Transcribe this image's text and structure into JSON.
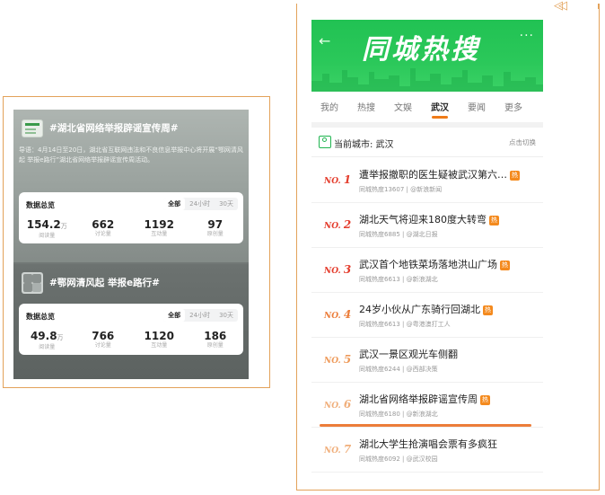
{
  "left": {
    "topic1": {
      "title": "#湖北省网络举报辟谣宣传周#",
      "desc": "导语：4月14日至20日，湖北省互联网违法和不良信息举报中心将开展“鄂网清风起 举报e路行”湖北省网络举报辟谣宣传周活动。",
      "stats_title": "数据总览",
      "tabs": [
        "全部",
        "24小时",
        "30天"
      ],
      "stats": [
        {
          "value": "154.2",
          "unit": "万",
          "label": "阅读量"
        },
        {
          "value": "662",
          "unit": "",
          "label": "讨论量"
        },
        {
          "value": "1192",
          "unit": "",
          "label": "互动量"
        },
        {
          "value": "97",
          "unit": "",
          "label": "原创量"
        }
      ]
    },
    "topic2": {
      "title": "#鄂网清风起 举报e路行#",
      "stats_title": "数据总览",
      "tabs": [
        "全部",
        "24小时",
        "30天"
      ],
      "stats": [
        {
          "value": "49.8",
          "unit": "万",
          "label": "阅读量"
        },
        {
          "value": "766",
          "unit": "",
          "label": "讨论量"
        },
        {
          "value": "1120",
          "unit": "",
          "label": "互动量"
        },
        {
          "value": "186",
          "unit": "",
          "label": "原创量"
        }
      ]
    }
  },
  "right": {
    "banner_title": "同城热搜",
    "back_icon": "arrow-left-icon",
    "more_icon": "more-dots-icon",
    "tabs": [
      "我的",
      "热搜",
      "文娱",
      "武汉",
      "要闻",
      "更多"
    ],
    "active_tab": "武汉",
    "city_label": "当前城市: 武汉",
    "city_switch": "点击切换",
    "hot_badge": "热",
    "items": [
      {
        "rank": "NO.",
        "num": "1",
        "title": "遭举报撤职的医生疑被武汉第六…",
        "sub": "同城热度13607 | @新浪新闻"
      },
      {
        "rank": "NO.",
        "num": "2",
        "title": "湖北天气将迎来180度大转弯",
        "sub": "同城热度6885 | @湖北日报"
      },
      {
        "rank": "NO.",
        "num": "3",
        "title": "武汉首个地铁菜场落地洪山广场",
        "sub": "同城热度6613 | @新浪湖北"
      },
      {
        "rank": "NO.",
        "num": "4",
        "title": "24岁小伙从广东骑行回湖北",
        "sub": "同城热度6613 | @粤港澳打工人"
      },
      {
        "rank": "NO.",
        "num": "5",
        "title": "武汉一景区观光车侧翻",
        "sub": "同城热度6244 | @西部决策"
      },
      {
        "rank": "NO.",
        "num": "6",
        "title": "湖北省网络举报辟谣宣传周",
        "sub": "同城热度6180 | @新浪湖北"
      },
      {
        "rank": "NO.",
        "num": "7",
        "title": "湖北大学生抢演唱会票有多疯狂",
        "sub": "同城热度6092 | @武汉校园"
      }
    ]
  },
  "colors": {
    "accent": "#ef7b18",
    "brand_green": "#21c253",
    "frame": "#e3a25a"
  }
}
